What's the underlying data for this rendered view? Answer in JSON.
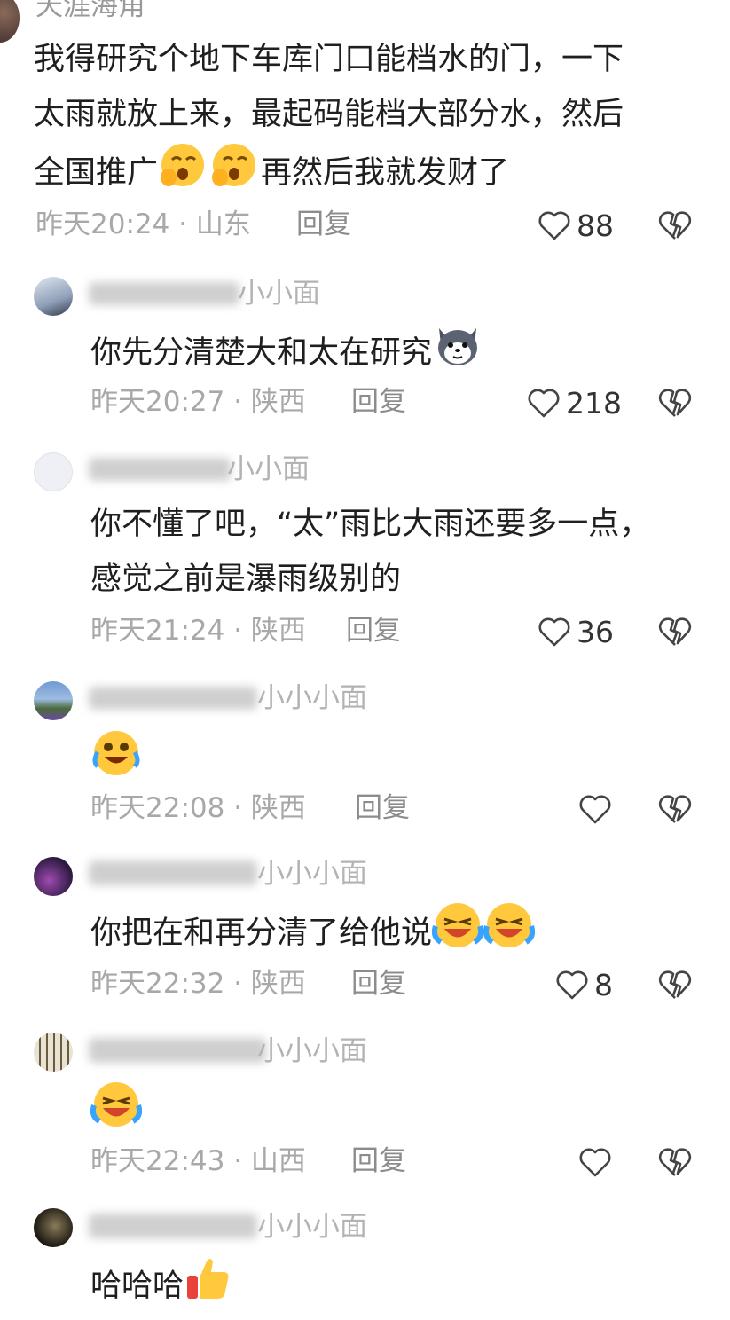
{
  "comments": [
    {
      "username": "天涯海角",
      "text_lines": [
        "我得研究个地下车库门口能档水的门，一下",
        "太雨就放上来，最起码能档大部分水，然后",
        "全国推广"
      ],
      "text_tail": "再然后我就发财了",
      "time": "昨天20:24",
      "location": "山东",
      "reply": "回复",
      "likes": "88"
    },
    {
      "username": "小小面",
      "text": "你先分清楚大和太在研究",
      "time": "昨天20:27",
      "location": "陕西",
      "reply": "回复",
      "likes": "218"
    },
    {
      "username": "小小面",
      "text_lines": [
        "你不懂了吧，“太”雨比大雨还要多一点，",
        "感觉之前是瀑雨级别的"
      ],
      "time": "昨天21:24",
      "location": "陕西",
      "reply": "回复",
      "likes": "36"
    },
    {
      "username": "小小小面",
      "time": "昨天22:08",
      "location": "陕西",
      "reply": "回复",
      "likes": ""
    },
    {
      "username": "小小小面",
      "text": "你把在和再分清了给他说",
      "time": "昨天22:32",
      "location": "陕西",
      "reply": "回复",
      "likes": "8"
    },
    {
      "username": "小小小面",
      "time": "昨天22:43",
      "location": "山西",
      "reply": "回复",
      "likes": ""
    },
    {
      "username": "小小小面",
      "text": "哈哈哈"
    }
  ],
  "separator": "·",
  "icons": {
    "like": "heart-outline-icon",
    "dislike": "broken-heart-icon"
  },
  "colors": {
    "text": "#1f1f1f",
    "meta": "#a8a8a8",
    "username": "#b3b3b3"
  }
}
